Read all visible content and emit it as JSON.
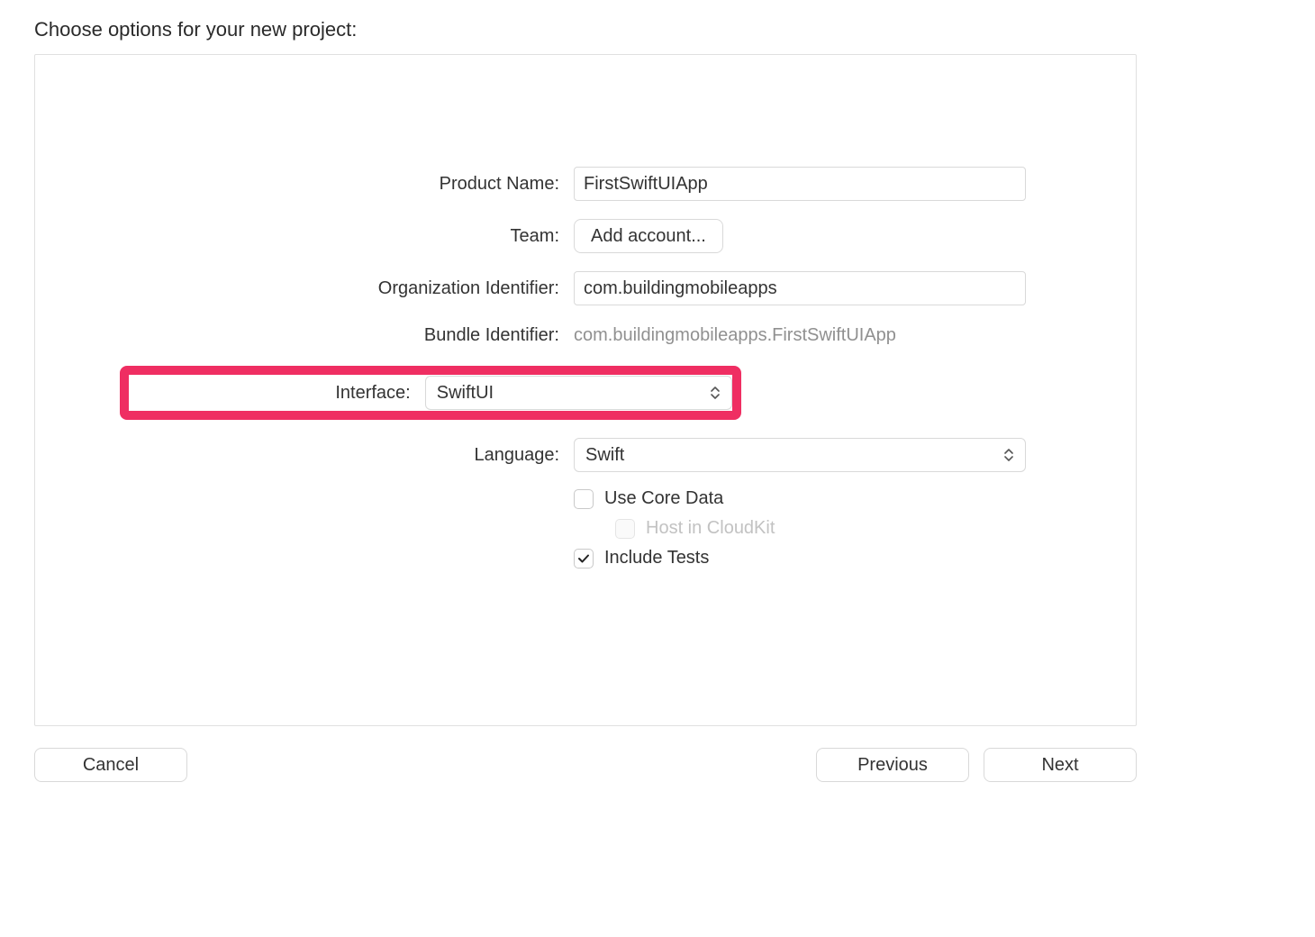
{
  "title": "Choose options for your new project:",
  "form": {
    "productName": {
      "label": "Product Name:",
      "value": "FirstSwiftUIApp"
    },
    "team": {
      "label": "Team:",
      "buttonLabel": "Add account..."
    },
    "orgIdentifier": {
      "label": "Organization Identifier:",
      "value": "com.buildingmobileapps"
    },
    "bundleIdentifier": {
      "label": "Bundle Identifier:",
      "value": "com.buildingmobileapps.FirstSwiftUIApp"
    },
    "interface": {
      "label": "Interface:",
      "value": "SwiftUI"
    },
    "language": {
      "label": "Language:",
      "value": "Swift"
    },
    "useCoreData": {
      "label": "Use Core Data",
      "checked": false
    },
    "hostCloudKit": {
      "label": "Host in CloudKit",
      "checked": false,
      "enabled": false
    },
    "includeTests": {
      "label": "Include Tests",
      "checked": true
    }
  },
  "buttons": {
    "cancel": "Cancel",
    "previous": "Previous",
    "next": "Next"
  }
}
